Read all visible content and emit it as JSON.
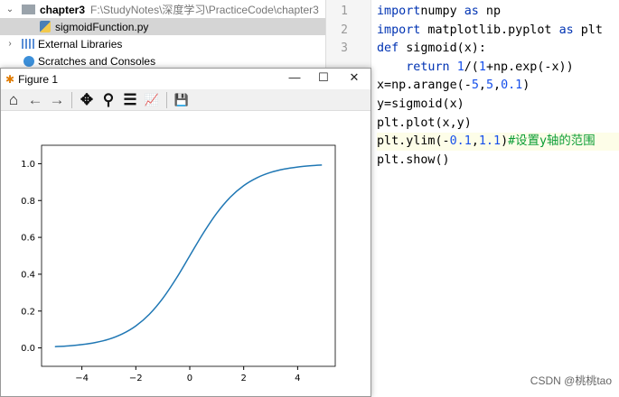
{
  "tree": {
    "folder": "chapter3",
    "folder_path": "F:\\StudyNotes\\深度学习\\PracticeCode\\chapter3",
    "file": "sigmoidFunction.py",
    "ext_libs": "External Libraries",
    "scratches": "Scratches and Consoles"
  },
  "editor": {
    "line_numbers": [
      "1",
      "2",
      "3"
    ],
    "lines": [
      [
        [
          "kw",
          "import"
        ],
        [
          "",
          "numpy "
        ],
        [
          "kw",
          "as"
        ],
        [
          "",
          " np"
        ]
      ],
      [
        [
          "kw",
          "import"
        ],
        [
          "",
          " matplotlib.pyplot "
        ],
        [
          "kw",
          "as"
        ],
        [
          "",
          " plt"
        ]
      ],
      [
        [
          "kw",
          "def"
        ],
        [
          "",
          " sigmoid(x):"
        ]
      ],
      [
        [
          "",
          "    "
        ],
        [
          "kw",
          "return "
        ],
        [
          "num",
          "1"
        ],
        [
          "",
          "/("
        ],
        [
          "num",
          "1"
        ],
        [
          "",
          "+np.exp(-x))"
        ]
      ],
      [
        [
          "",
          "x=np.arange(-"
        ],
        [
          "num",
          "5"
        ],
        [
          "",
          ","
        ],
        [
          "num",
          "5"
        ],
        [
          "",
          ","
        ],
        [
          "num",
          "0.1"
        ],
        [
          "",
          ")"
        ]
      ],
      [
        [
          "",
          "y=sigmoid(x)"
        ]
      ],
      [
        [
          "",
          "plt.plot(x,y)"
        ]
      ],
      [
        [
          "",
          "plt.ylim(-"
        ],
        [
          "num",
          "0.1"
        ],
        [
          "",
          ","
        ],
        [
          "num",
          "1.1"
        ],
        [
          "",
          ")"
        ],
        [
          "cm",
          "#设置y轴的范围"
        ]
      ],
      [
        [
          "",
          "plt.show()"
        ]
      ]
    ]
  },
  "figure": {
    "title": "Figure 1",
    "minimize": "—",
    "maximize": "☐",
    "close": "✕"
  },
  "toolbar": {
    "home": "⌂",
    "back": "←",
    "forward": "→",
    "pan": "✥",
    "zoom": "⚲",
    "configure": "☰",
    "edit": "📈",
    "save": "💾"
  },
  "watermark": "CSDN @桃桃tao",
  "chart_data": {
    "type": "line",
    "title": "",
    "xlabel": "",
    "ylabel": "",
    "xlim": [
      -5.495,
      5.395
    ],
    "ylim": [
      -0.1,
      1.1
    ],
    "xticks": [
      -4,
      -2,
      0,
      2,
      4
    ],
    "xtick_labels": [
      "−4",
      "−2",
      "0",
      "2",
      "4"
    ],
    "yticks": [
      0,
      0.2,
      0.4,
      0.6,
      0.8,
      1.0
    ],
    "ytick_labels": [
      "0.0",
      "0.2",
      "0.4",
      "0.6",
      "0.8",
      "1.0"
    ],
    "color": "#1f77b4",
    "series": [
      {
        "name": "sigmoid",
        "x": [
          -5,
          -4.5,
          -4,
          -3.5,
          -3,
          -2.5,
          -2,
          -1.5,
          -1,
          -0.5,
          0,
          0.5,
          1,
          1.5,
          2,
          2.5,
          3,
          3.5,
          4,
          4.5,
          4.9
        ],
        "y": [
          0.0067,
          0.011,
          0.018,
          0.0293,
          0.0474,
          0.0759,
          0.1192,
          0.1824,
          0.2689,
          0.3775,
          0.5,
          0.6225,
          0.7311,
          0.8176,
          0.8808,
          0.9241,
          0.9526,
          0.9707,
          0.982,
          0.989,
          0.9926
        ]
      }
    ]
  }
}
